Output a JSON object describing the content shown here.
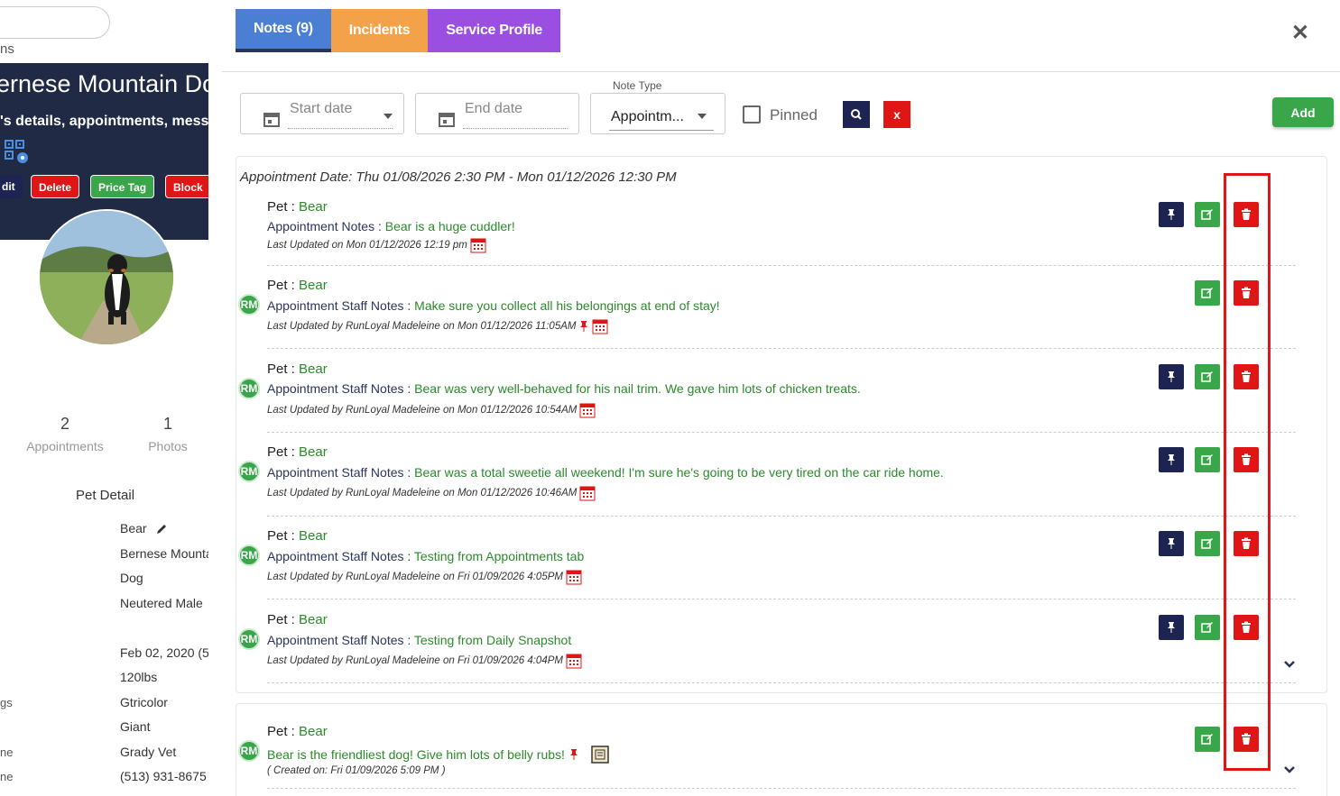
{
  "left": {
    "cut_label": "ns",
    "breed_title": "ernese Mountain Do",
    "subtitle": "'s details, appointments, messa",
    "buttons": [
      {
        "label": "dit",
        "color": "#1d2452"
      },
      {
        "label": "Delete",
        "color": "#e01515"
      },
      {
        "label": "Price Tag",
        "color": "#3aa64a"
      },
      {
        "label": "Block",
        "color": "#e01515"
      }
    ],
    "stats": [
      {
        "num": "2",
        "label": "Appointments"
      },
      {
        "num": "1",
        "label": "Photos"
      }
    ],
    "pet_detail_title": "Pet Detail",
    "details": [
      "Bear",
      "Bernese Mounta",
      "Dog",
      "Neutered Male",
      "Feb 02, 2020  (5)",
      "120lbs",
      "Gtricolor",
      "Giant",
      "Grady Vet",
      "(513) 931-8675"
    ],
    "side_labels": [
      "gs",
      "ne",
      "ne"
    ]
  },
  "modal": {
    "tabs": [
      {
        "label": "Notes (9)",
        "color": "#4a7fd4"
      },
      {
        "label": "Incidents",
        "color": "#f4a24a"
      },
      {
        "label": "Service Profile",
        "color": "#9b4fe0"
      }
    ],
    "close": "✕",
    "filters": {
      "start_placeholder": "Start date",
      "end_placeholder": "End date",
      "note_type_label": "Note Type",
      "note_type_value": "Appointm...",
      "pinned_label": "Pinned",
      "add_label": "Add",
      "clear_label": "x"
    },
    "appointment_date": "Appointment Date: Thu 01/08/2026 2:30 PM - Mon 01/12/2026 12:30 PM",
    "notes": [
      {
        "pet_key": "Pet : ",
        "pet": "Bear",
        "key": "Appointment Notes : ",
        "text": "Bear is a huge cuddler!",
        "meta": "Last Updated on Mon 01/12/2026 12:19 pm"
      },
      {
        "pet_key": "Pet : ",
        "pet": "Bear",
        "avatar": "RM",
        "key": "Appointment Staff Notes : ",
        "text": "Make sure you collect all his belongings at end of stay!",
        "meta": "Last Updated by RunLoyal Madeleine on Mon 01/12/2026 11:05AM"
      },
      {
        "pet_key": "Pet : ",
        "pet": "Bear",
        "avatar": "RM",
        "key": "Appointment Staff Notes : ",
        "text": "Bear was very well-behaved for his nail trim. We gave him lots of chicken treats.",
        "meta": "Last Updated by RunLoyal Madeleine on Mon 01/12/2026 10:54AM"
      },
      {
        "pet_key": "Pet : ",
        "pet": "Bear",
        "avatar": "RM",
        "key": "Appointment Staff Notes : ",
        "text": "Bear was a total sweetie all weekend! I'm sure he's going to be very tired on the car ride home.",
        "meta": "Last Updated by RunLoyal Madeleine on Mon 01/12/2026 10:46AM"
      },
      {
        "pet_key": "Pet : ",
        "pet": "Bear",
        "avatar": "RM",
        "key": "Appointment Staff Notes : ",
        "text": "Testing from Appointments tab",
        "meta": "Last Updated by RunLoyal Madeleine on Fri 01/09/2026 4:05PM"
      },
      {
        "pet_key": "Pet : ",
        "pet": "Bear",
        "avatar": "RM",
        "key": "Appointment Staff Notes : ",
        "text": "Testing from Daily Snapshot",
        "meta": "Last Updated by RunLoyal Madeleine on Fri 01/09/2026 4:04PM"
      }
    ],
    "general_note": {
      "pet_key": "Pet : ",
      "pet": "Bear",
      "avatar": "RM",
      "text": "Bear is the friendliest dog! Give him lots of belly rubs!",
      "meta": "( Created on: Fri 01/09/2026 5:09 PM )"
    }
  },
  "colors": {
    "navy": "#1d2452",
    "green": "#3aa64a",
    "red": "#e01515",
    "note_green": "#2b8a2b"
  }
}
